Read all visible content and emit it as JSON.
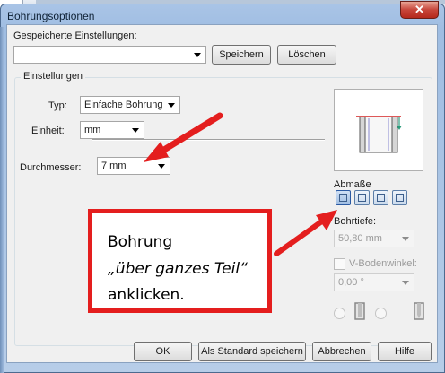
{
  "window": {
    "title": "Bohrungsoptionen",
    "close_glyph": "✕"
  },
  "saved_settings": {
    "label": "Gespeicherte Einstellungen:",
    "value": "",
    "save_label": "Speichern",
    "delete_label": "Löschen"
  },
  "settings": {
    "group_label": "Einstellungen",
    "type_label": "Typ:",
    "type_value": "Einfache Bohrung",
    "unit_label": "Einheit:",
    "unit_value": "mm",
    "diameter_label": "Durchmesser:",
    "diameter_value": "7 mm"
  },
  "dimensions": {
    "label": "Abmaße",
    "depth_label": "Bohrtiefe:",
    "depth_value": "50,80 mm",
    "angle_label": "V-Bodenwinkel:",
    "angle_value": "0,00 °"
  },
  "callout": {
    "line1": "Bohrung",
    "line2": "„über ganzes Teil“",
    "line3": "anklicken."
  },
  "footer": {
    "ok_label": "OK",
    "default_label": "Als Standard speichern",
    "cancel_label": "Abbrechen",
    "help_label": "Hilfe"
  },
  "colors": {
    "annotation": "#e41e1e",
    "title_bar": "#a9c4e6"
  }
}
